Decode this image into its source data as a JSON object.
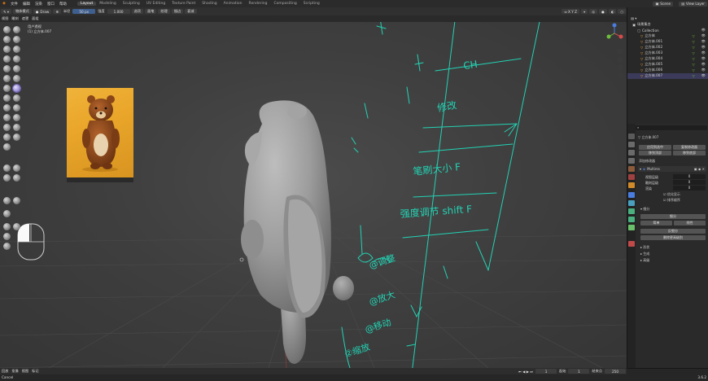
{
  "menubar": {
    "items": [
      "文件",
      "编辑",
      "渲染",
      "窗口",
      "帮助"
    ],
    "workspaces": [
      "Layout",
      "Modeling",
      "Sculpting",
      "UV Editing",
      "Texture Paint",
      "Shading",
      "Animation",
      "Rendering",
      "Compositing",
      "Scripting"
    ],
    "scene_label": "Scene",
    "view_layer_label": "View Layer"
  },
  "header": {
    "mode_label": "物体模式",
    "brush_label": "Draw",
    "radius_value": "50 px",
    "strength_value": "1.000",
    "menus": [
      "视图",
      "雕刻",
      "遮罩",
      "面组",
      "面部集合"
    ],
    "view_options": [
      "选项",
      "画笔",
      "纹理",
      "描边",
      "衰减"
    ]
  },
  "subbar": {
    "items": [
      "视图",
      "雕刻",
      "遮罩",
      "面组"
    ]
  },
  "viewport": {
    "view_name": "用户透视",
    "object_info": "(1) 立方体.007",
    "search_placeholder": "搜索"
  },
  "outliner": {
    "title": "场景集合",
    "collection": "Collection",
    "objects": [
      "立方体",
      "立方体.001",
      "立方体.002",
      "立方体.003",
      "立方体.004",
      "立方体.005",
      "立方体.006",
      "立方体.007"
    ],
    "selected_index": 7
  },
  "properties": {
    "object_name": "立方体.007",
    "modifier_header": "添加修改器",
    "modifier_name": "Multires",
    "top_buttons": [
      "应用到选中",
      "复制修改器",
      "移到顶部",
      "移到底部"
    ],
    "fields": [
      {
        "label": "视图层级",
        "value": "0"
      },
      {
        "label": "雕刻层级",
        "value": "0"
      },
      {
        "label": "渲染",
        "value": "0"
      }
    ],
    "checkboxes": [
      "优化显示",
      "排序顺序"
    ],
    "section_subdiv": "细分",
    "subdiv_buttons": [
      "细分",
      "简单",
      "线性"
    ],
    "reshape_buttons": [
      "反细分",
      "删除更高级别"
    ],
    "extra_buttons": [
      "重塑",
      "应用基形"
    ],
    "sections": [
      "形状",
      "生成",
      "高级"
    ]
  },
  "annotations": {
    "lines": [
      "CH",
      "修改",
      "笔刷大小 F",
      "强度调节 shift F",
      "@调整",
      "@放大",
      "@移动",
      "②缩放"
    ]
  },
  "timeline": {
    "items": [
      "回放",
      "抠像",
      "视图",
      "标记"
    ],
    "frame_current": "1",
    "frame_start": "1",
    "frame_end": "250"
  },
  "status": {
    "left": "Cancel",
    "right": "3.6.2"
  },
  "colors": {
    "annotation": "#22d3b4",
    "selection": "#6d5fb0",
    "workspace_active": "#454545"
  }
}
